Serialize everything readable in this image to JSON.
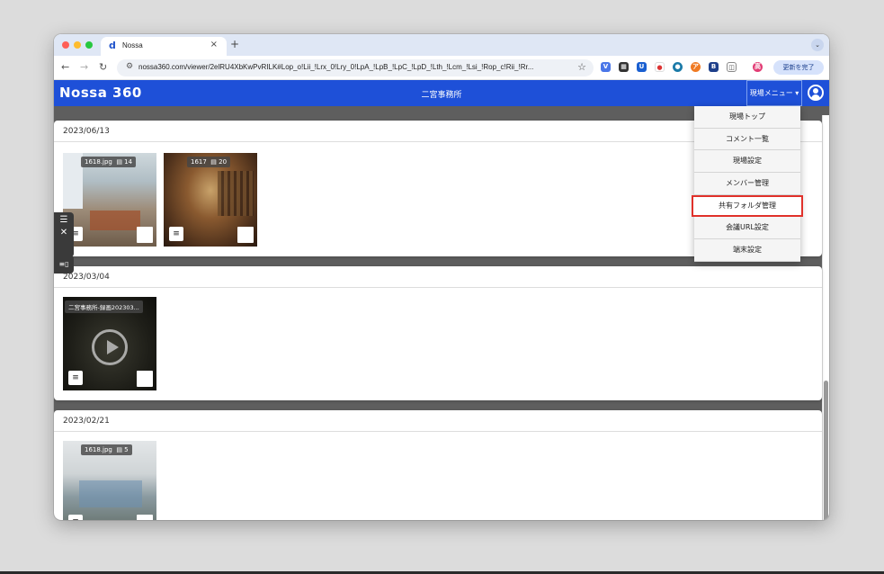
{
  "browser": {
    "tab_title": "Nossa",
    "tab_favicon": "d",
    "new_tab": "+",
    "url": "nossa360.com/viewer/2elRU4XbKwPvRILK#Lop_o!Lii_!Lrx_0!Lry_0!LpA_!LpB_!LpC_!LpD_!Lth_!Lcm_!Lsi_!Rop_c!Rii_!Rr...",
    "update_button": "更新を完了",
    "colors": {
      "tab_bar": "#dfe7f5",
      "window_bg": "#dcdcdc"
    }
  },
  "app": {
    "logo": "Nossa 360",
    "title": "二宮事務所",
    "menu_button": "現場メニュー ▾",
    "colors": {
      "header": "#1e50d8",
      "content_bg": "#5e5e5e",
      "highlight": "#e0312a"
    }
  },
  "menu": {
    "items": [
      {
        "label": "現場トップ"
      },
      {
        "label": "コメント一覧"
      },
      {
        "label": "現場設定"
      },
      {
        "label": "メンバー管理"
      },
      {
        "label": "共有フォルダ管理",
        "highlighted": true
      },
      {
        "label": "会議URL設定"
      },
      {
        "label": "端末設定"
      }
    ]
  },
  "sections": [
    {
      "date": "2023/06/13",
      "items": [
        {
          "name": "1618.jpg",
          "count": "14"
        },
        {
          "name": "1617",
          "count": "20"
        }
      ]
    },
    {
      "date": "2023/03/04",
      "items": [
        {
          "name": "二宮事務所-録画202303..."
        }
      ]
    },
    {
      "date": "2023/02/21",
      "items": [
        {
          "name": "1618.jpg",
          "count": "5"
        }
      ]
    }
  ]
}
